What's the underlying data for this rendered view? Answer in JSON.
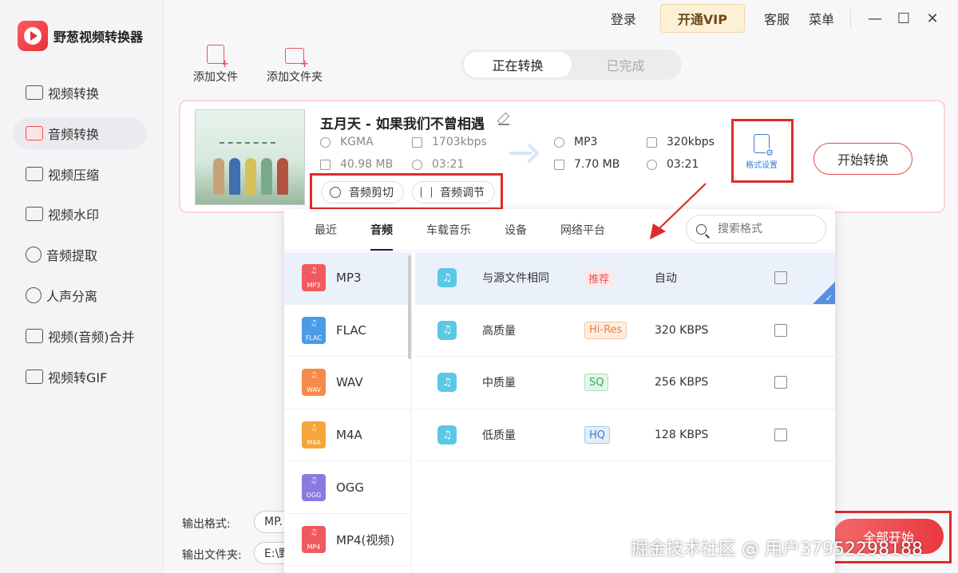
{
  "app": {
    "title": "野葱视频转换器"
  },
  "topbar": {
    "login": "登录",
    "vip": "开通VIP",
    "service": "客服",
    "menu": "菜单",
    "minimize": "—",
    "maximize": "☐",
    "close": "✕"
  },
  "sidebar": {
    "items": [
      {
        "label": "视频转换"
      },
      {
        "label": "音频转换"
      },
      {
        "label": "视频压缩"
      },
      {
        "label": "视频水印"
      },
      {
        "label": "音频提取"
      },
      {
        "label": "人声分离"
      },
      {
        "label": "视频(音频)合并"
      },
      {
        "label": "视频转GIF"
      }
    ]
  },
  "toolbar": {
    "add_file": "添加文件",
    "add_folder": "添加文件夹"
  },
  "tabs": {
    "converting": "正在转换",
    "completed": "已完成"
  },
  "file": {
    "title": "五月天 - 如果我们不曾相遇",
    "source": {
      "format": "KGMA",
      "bitrate": "1703kbps",
      "size": "40.98 MB",
      "duration": "03:21"
    },
    "target": {
      "format": "MP3",
      "bitrate": "320kbps",
      "size": "7.70 MB",
      "duration": "03:21"
    },
    "chips": {
      "cut": "音频剪切",
      "adjust": "音频调节"
    },
    "format_settings": "格式设置",
    "start": "开始转换"
  },
  "output": {
    "format_label": "输出格式:",
    "format_value": "MP.",
    "folder_label": "输出文件夹:",
    "folder_value": "E:\\野"
  },
  "all_start": "全部开始",
  "popup": {
    "tabs": [
      "最近",
      "音频",
      "车载音乐",
      "设备",
      "网络平台"
    ],
    "search_placeholder": "搜索格式",
    "formats": [
      {
        "name": "MP3",
        "badge": "MP3",
        "color": "#f0595f"
      },
      {
        "name": "FLAC",
        "badge": "FLAC",
        "color": "#4a9ce8"
      },
      {
        "name": "WAV",
        "badge": "WAV",
        "color": "#f58a4a"
      },
      {
        "name": "M4A",
        "badge": "M4A",
        "color": "#f5a53a"
      },
      {
        "name": "OGG",
        "badge": "OGG",
        "color": "#8a7ae0"
      },
      {
        "name": "MP4(视频)",
        "badge": "MP4",
        "color": "#f0595f"
      }
    ],
    "qualities": [
      {
        "name": "与源文件相同",
        "tag": "推荐",
        "tag_color": "#e8535b",
        "tag_bg": "#fde8e8",
        "bitrate": "自动"
      },
      {
        "name": "高质量",
        "tag": "Hi-Res",
        "tag_color": "#f07a3a",
        "tag_bg": "#fdeee3",
        "bitrate": "320 KBPS"
      },
      {
        "name": "中质量",
        "tag": "SQ",
        "tag_color": "#2fae5a",
        "tag_bg": "#e3f6e9",
        "bitrate": "256 KBPS"
      },
      {
        "name": "低质量",
        "tag": "HQ",
        "tag_color": "#3a7bd5",
        "tag_bg": "#e4eefb",
        "bitrate": "128 KBPS"
      }
    ]
  },
  "watermark": "掘金技术社区 @ 用户3795229818​8"
}
